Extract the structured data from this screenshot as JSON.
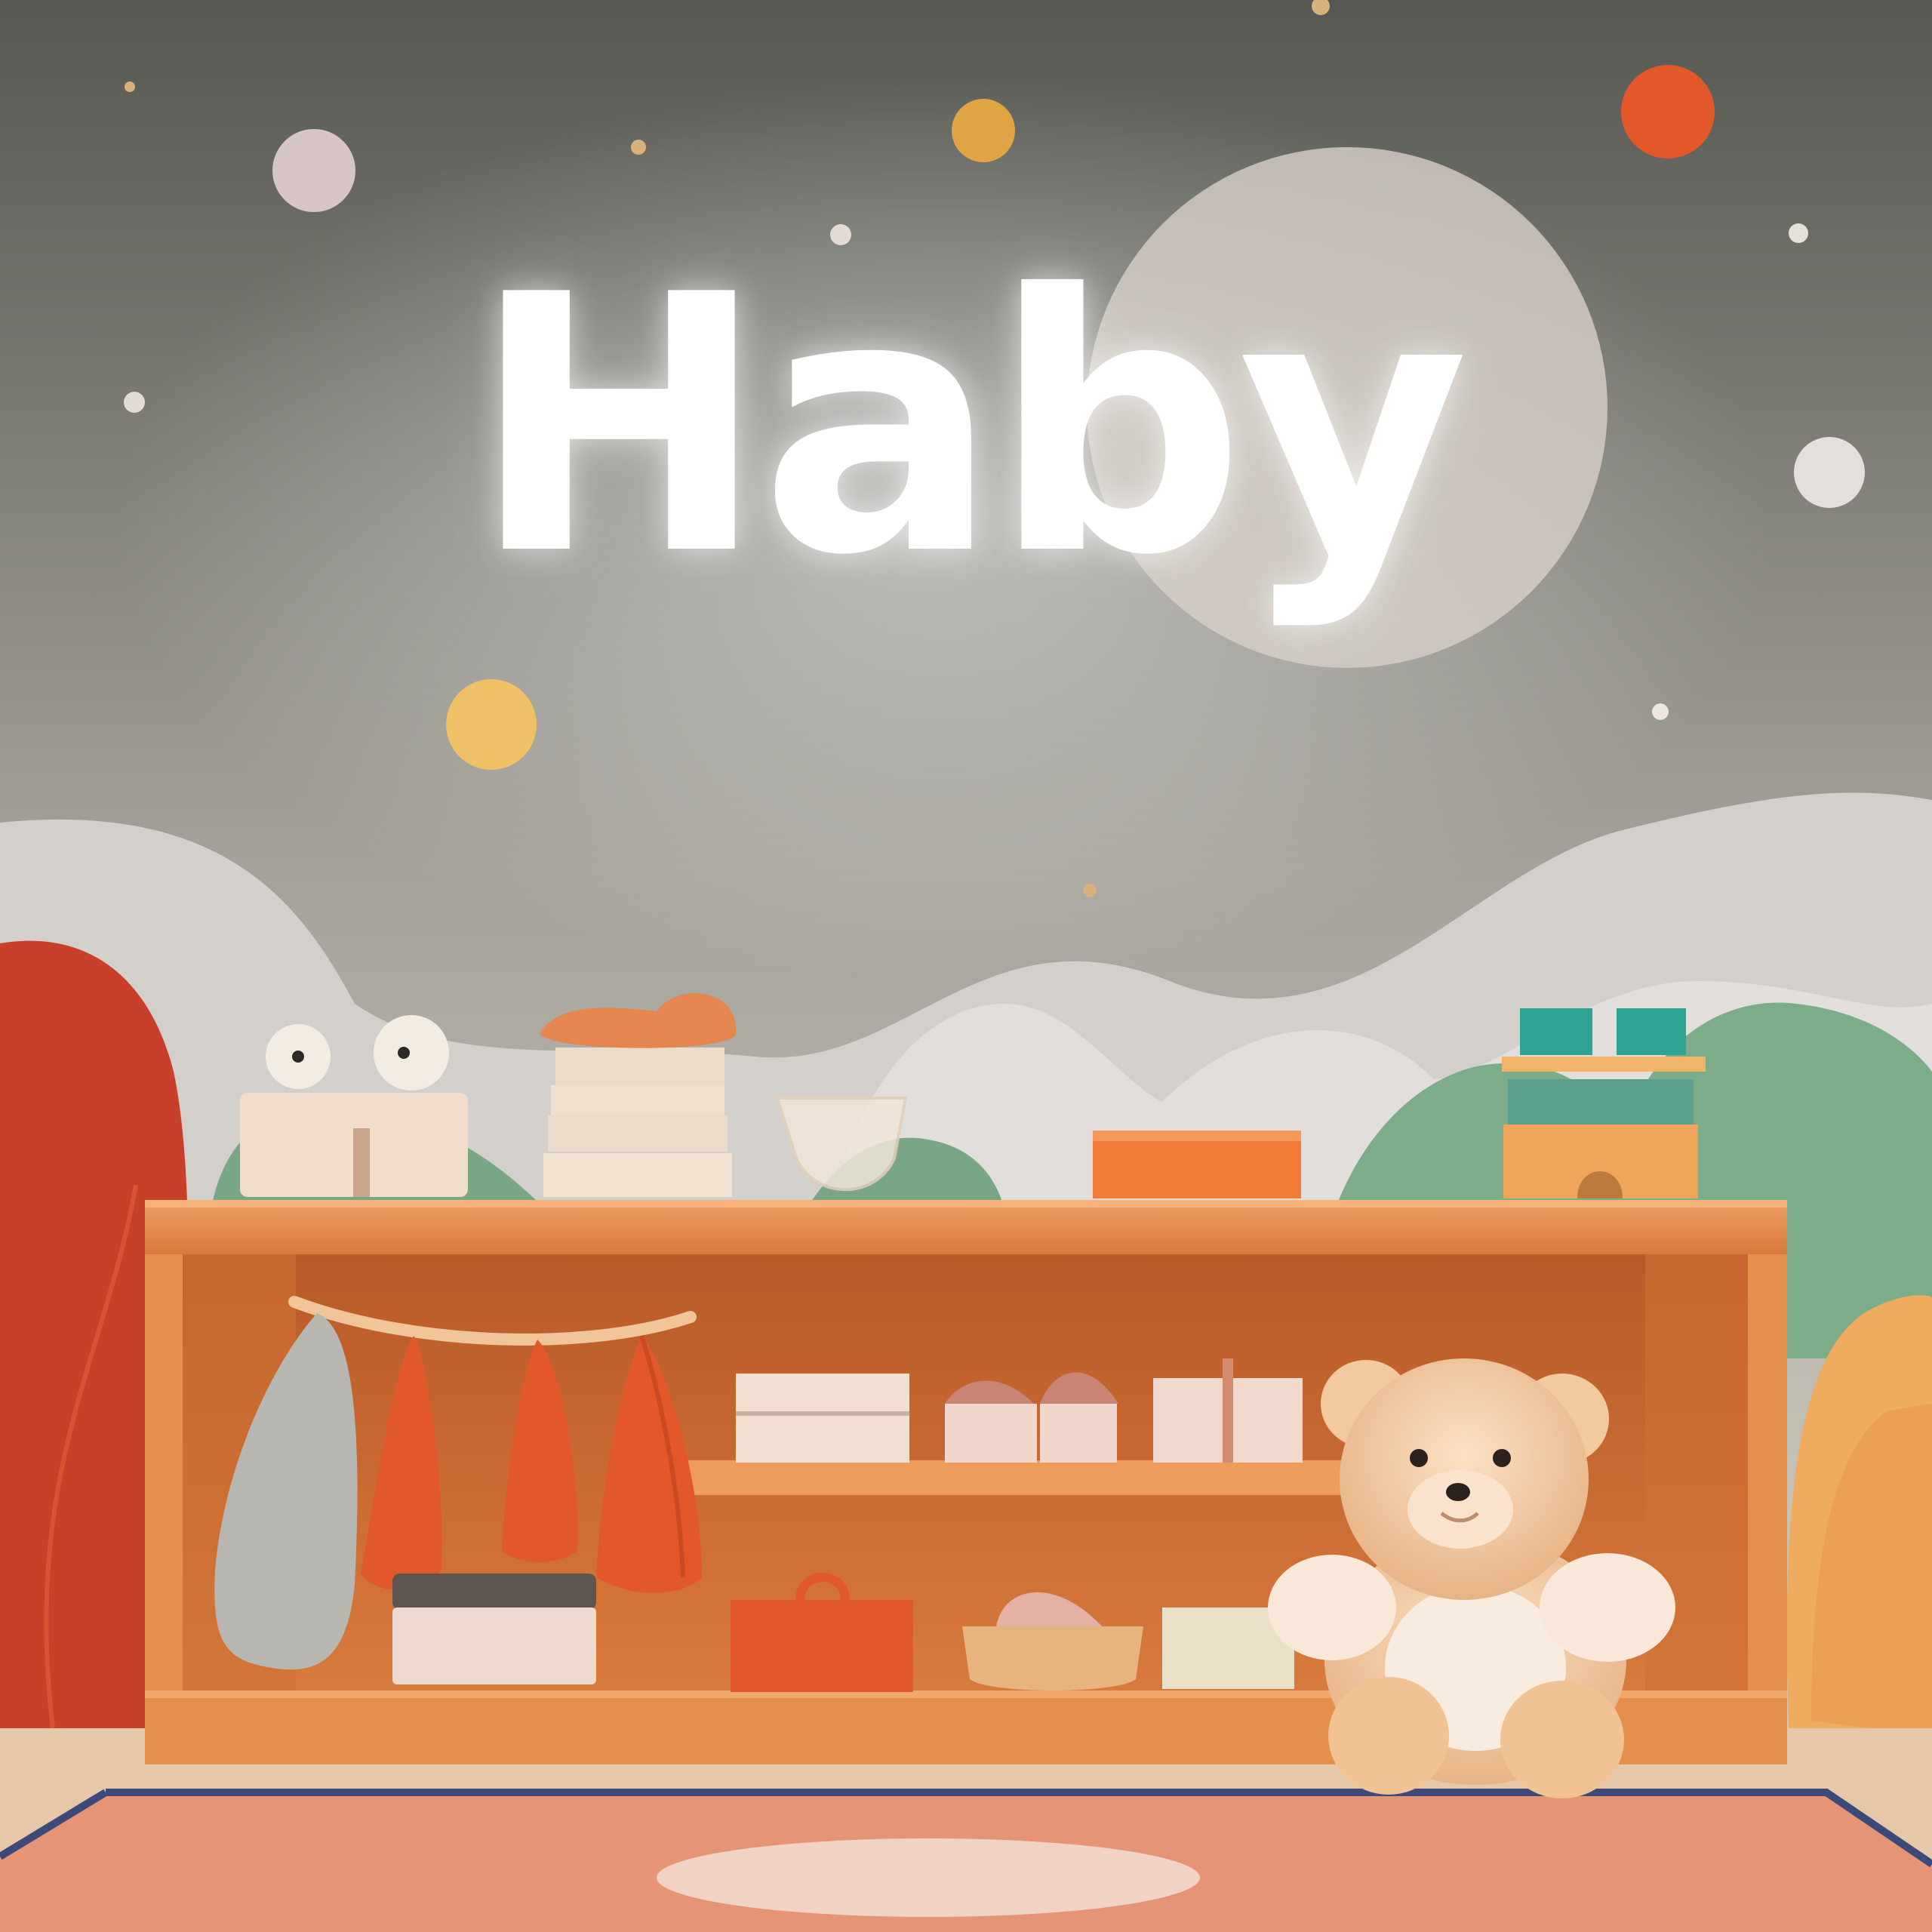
{
  "scene": {
    "brand_text": "Haby"
  },
  "colors": {
    "wall_top": "#5a5a56",
    "wall_bottom": "#d6d2c6",
    "shelf": "#e58f4c",
    "shelf_inner": "#cf6f32",
    "hills_light": "#d8d4d0",
    "hills_green": "#79a685",
    "accent_orange": "#e2582a",
    "accent_yellow": "#e8b15a",
    "bear": "#f1c79e",
    "rug": "#e59475"
  },
  "objects": [
    "wall-lettering",
    "decorative-dots",
    "rolling-hills",
    "wooden-shelf",
    "hanging-towels",
    "storage-boxes",
    "teddy-bear",
    "rug"
  ]
}
